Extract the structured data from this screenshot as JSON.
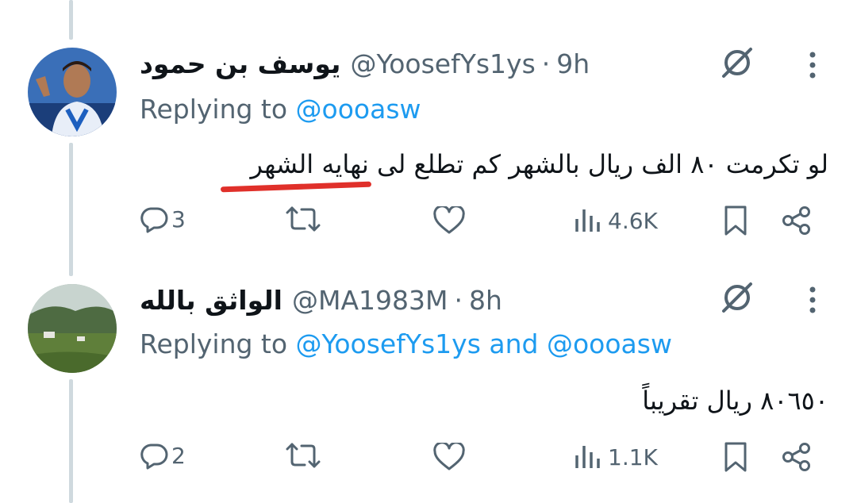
{
  "tweets": [
    {
      "author_name": "يوسف بن حمود",
      "handle": "@YoosefYs1ys",
      "separator": "·",
      "time": "9h",
      "replying_prefix": "Replying to",
      "replying_mentions": [
        "@oooasw"
      ],
      "replying_joiner": "",
      "text": "لو تكرمت ٨٠ الف ريال بالشهر كم تطلع لى نهايه الشهر",
      "replies": "3",
      "retweets": "",
      "likes": "",
      "views": "4.6K"
    },
    {
      "author_name": "الواثق بالله",
      "handle": "@MA1983M",
      "separator": "·",
      "time": "8h",
      "replying_prefix": "Replying to",
      "replying_mentions": [
        "@YoosefYs1ys",
        "@oooasw"
      ],
      "replying_joiner": "and",
      "text": "٨٠٦٥٠ ريال تقريباً",
      "replies": "2",
      "retweets": "",
      "likes": "",
      "views": "1.1K"
    }
  ],
  "icons": {
    "grok": "grok-icon",
    "more": "more-icon",
    "reply": "reply-icon",
    "retweet": "retweet-icon",
    "like": "like-icon",
    "views": "views-icon",
    "bookmark": "bookmark-icon",
    "share": "share-icon"
  },
  "colors": {
    "text": "#0f1419",
    "secondary": "#536471",
    "link": "#1d9bf0",
    "thread_line": "#cfd9de",
    "annotation": "#e0302a"
  }
}
